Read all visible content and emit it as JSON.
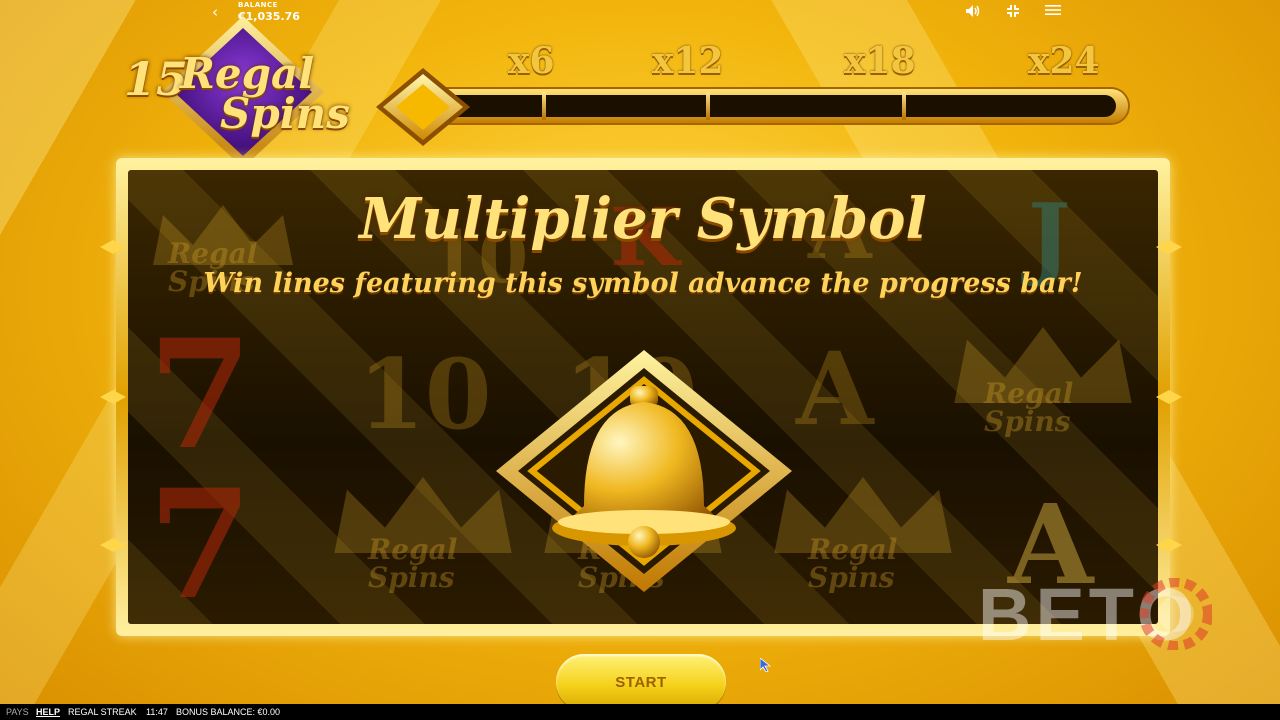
{
  "topbar": {
    "balance_label": "BALANCE",
    "balance_value": "€1,035.76",
    "icons": [
      "back-arrow-icon",
      "sound-icon",
      "fullscreen-icon",
      "menu-icon"
    ]
  },
  "badge": {
    "count": "15",
    "text_line1": "Regal",
    "text_line2": "Spins"
  },
  "progress": {
    "multipliers": [
      "x6",
      "x12",
      "x18",
      "x24"
    ],
    "filled_fraction": 0
  },
  "panel": {
    "title": "Multiplier Symbol",
    "subtitle": "Win lines featuring this symbol advance the progress bar!",
    "background_symbols": [
      "Regal Spins",
      "10",
      "K",
      "A",
      "J",
      "7",
      "10",
      "10",
      "A",
      "Regal Spins",
      "7",
      "Regal Spins",
      "Regal Spins",
      "Regal Spins",
      "A"
    ],
    "featured_symbol": "bell-icon"
  },
  "start_button": {
    "label": "START"
  },
  "watermark": {
    "logo": "BETO"
  },
  "bottombar": {
    "pays": "PAYS",
    "help": "HELP",
    "game_name": "REGAL STREAK",
    "time": "11:47",
    "bonus_balance": "BONUS BALANCE: €0.00"
  },
  "colors": {
    "gold": "#f2b50c",
    "panel_dark": "#1a1000",
    "title_gold": "#ffe27a",
    "badge_purple": "#5a1a9a"
  }
}
